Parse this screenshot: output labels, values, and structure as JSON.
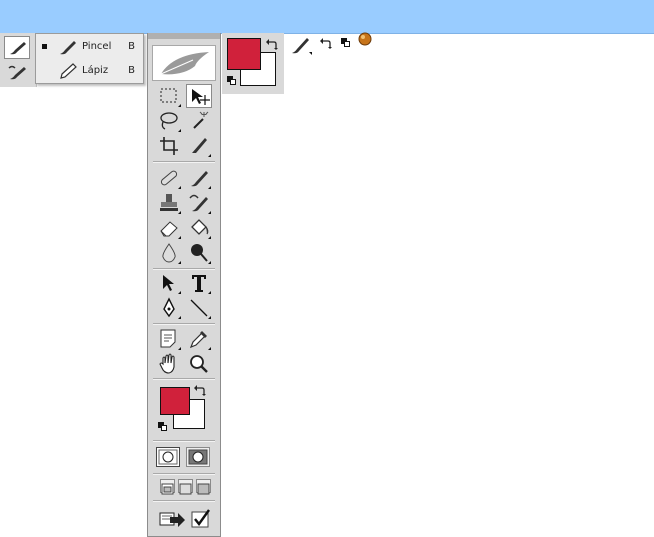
{
  "topbar": {
    "color": "#99ccff"
  },
  "colors": {
    "foreground": "#d0213b",
    "background": "#ffffff"
  },
  "mini_stack": {
    "items": [
      {
        "icon": "brush-icon",
        "active": true
      },
      {
        "icon": "history-brush-icon",
        "active": false
      }
    ]
  },
  "flyout": {
    "items": [
      {
        "icon": "brush-icon",
        "label": "Pincel",
        "shortcut": "B",
        "selected": true
      },
      {
        "icon": "pencil-icon",
        "label": "Lápiz",
        "shortcut": "B",
        "selected": false
      }
    ]
  },
  "toolbox": {
    "logo": "feather-logo",
    "tools": [
      "rectangular-marquee-icon",
      "move-icon",
      "lasso-icon",
      "magic-wand-icon",
      "crop-icon",
      "slice-icon",
      "healing-brush-icon",
      "brush-icon",
      "clone-stamp-icon",
      "history-brush-icon",
      "eraser-icon",
      "paint-bucket-icon",
      "blur-icon",
      "dodge-icon",
      "path-selection-icon",
      "type-icon",
      "pen-icon",
      "line-icon",
      "notes-icon",
      "eyedropper-icon",
      "hand-icon",
      "zoom-icon"
    ],
    "mode_buttons": [
      "standard-mode-icon",
      "quick-mask-mode-icon"
    ],
    "screen_buttons": [
      "standard-screen-icon",
      "full-screen-menu-icon",
      "full-screen-icon"
    ],
    "jump_buttons": [
      "jump-to-imageready-icon",
      "checkmark-icon"
    ]
  }
}
